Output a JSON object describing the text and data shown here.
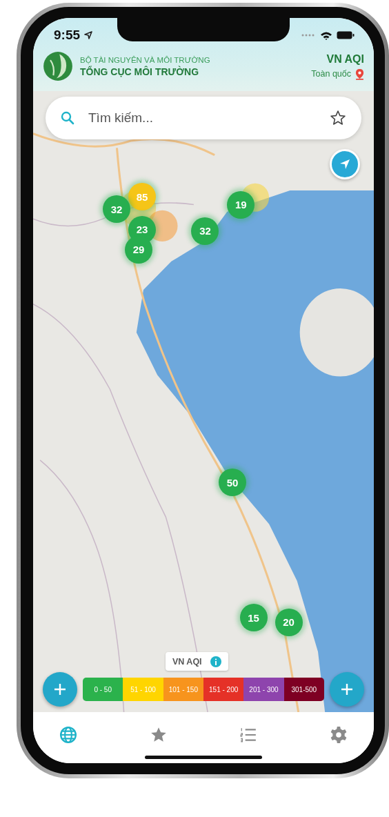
{
  "status_bar": {
    "time": "9:55"
  },
  "header": {
    "ministry": "BỘ TÀI NGUYÊN VÀ MÔI TRƯỜNG",
    "agency": "TỔNG CỤC MÔI TRƯỜNG",
    "index_name": "VN AQI",
    "region": "Toàn quốc"
  },
  "search": {
    "placeholder": "Tìm kiếm..."
  },
  "map": {
    "kind": "picture",
    "markers": [
      {
        "value": "85",
        "color": "#f5c518"
      },
      {
        "value": "32",
        "color": "#27ae4f"
      },
      {
        "value": "23",
        "color": "#27ae4f"
      },
      {
        "value": "29",
        "color": "#27ae4f"
      },
      {
        "value": "32",
        "color": "#27ae4f"
      },
      {
        "value": "19",
        "color": "#27ae4f"
      },
      {
        "value": "50",
        "color": "#27ae4f"
      },
      {
        "value": "15",
        "color": "#27ae4f"
      },
      {
        "value": "20",
        "color": "#27ae4f"
      }
    ]
  },
  "legend": {
    "title": "VN AQI",
    "ranges": [
      {
        "label": "0 - 50",
        "color": "#2bb24c"
      },
      {
        "label": "51 - 100",
        "color": "#ffd500"
      },
      {
        "label": "101 - 150",
        "color": "#f7941d"
      },
      {
        "label": "151 - 200",
        "color": "#e53127"
      },
      {
        "label": "201 - 300",
        "color": "#8e44ad"
      },
      {
        "label": "301-500",
        "color": "#7e0023"
      }
    ]
  },
  "tabs": [
    {
      "kind": "globe",
      "selected": true
    },
    {
      "kind": "star",
      "selected": false
    },
    {
      "kind": "list",
      "selected": false
    },
    {
      "kind": "gear",
      "selected": false
    }
  ]
}
